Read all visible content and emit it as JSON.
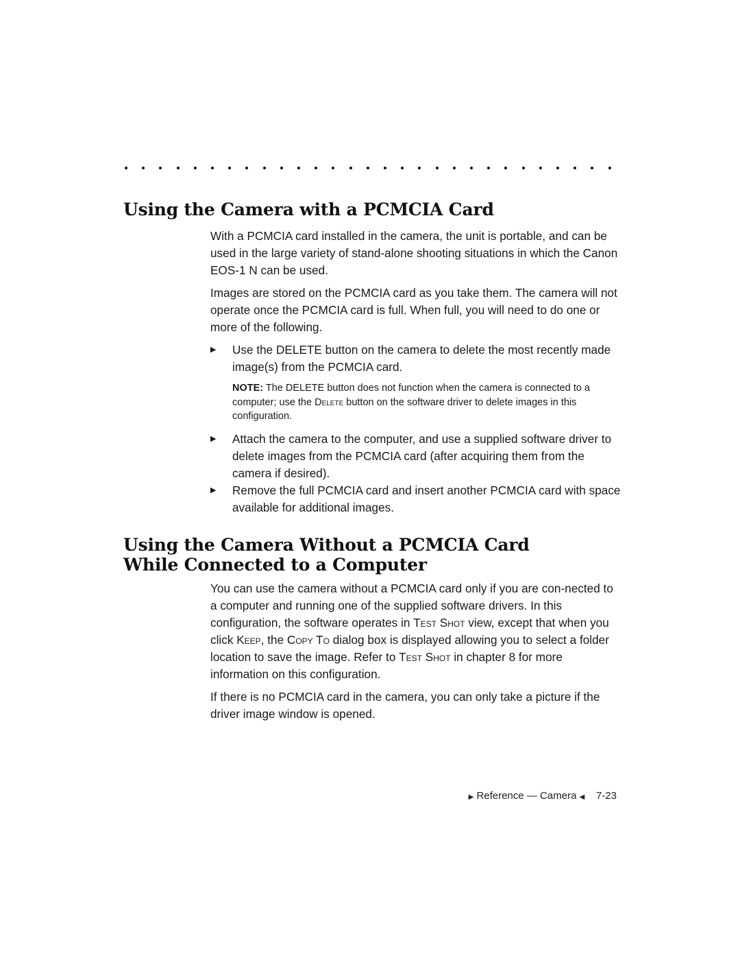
{
  "divider": {
    "dot_count": 29
  },
  "section1": {
    "heading": "Using the Camera with a PCMCIA Card",
    "para1": "With a PCMCIA card installed in the camera, the unit is portable, and can be used in the large variety of stand-alone shooting situations in which the Canon EOS-1 N can be used.",
    "para2": "Images are stored on the PCMCIA card as you take them. The camera will not operate once the PCMCIA card is full. When full, you will need to do one or more of the following.",
    "bullets": [
      {
        "glyph": "▶",
        "text": "Use the DELETE button on the camera to delete the most recently made image(s) from the PCMCIA card."
      },
      {
        "glyph": "▶",
        "text": "Attach the camera to the computer, and use a supplied software driver to delete images from the PCMCIA card (after acquiring them from the camera if desired)."
      },
      {
        "glyph": "▶",
        "text": "Remove the full PCMCIA card and insert another PCMCIA card with space available for additional images."
      }
    ],
    "note": {
      "label": "NOTE:",
      "text_before": " The DELETE button does not function when the camera is connected to a computer; use the ",
      "smallcaps": "Delete",
      "text_after": " button on the software driver to delete images in this configuration."
    }
  },
  "section2": {
    "heading_line1": "Using the Camera Without a PCMCIA Card",
    "heading_line2": "While Connected to a Computer",
    "para1": {
      "t1": "You can use the camera without a PCMCIA card only if you are con-nected to a computer and running one of the supplied software drivers. In this configuration, the software operates in ",
      "sc1": "Test Shot",
      "t2": " view, except that when you click ",
      "sc2": "Keep",
      "t3": ", the ",
      "sc3": "Copy To",
      "t4": " dialog box is displayed allowing you to select a folder location to save the image. Refer to ",
      "sc4": "Test Shot",
      "t5": " in chapter 8 for more information on this configuration."
    },
    "para2": "If there is no PCMCIA card in the camera, you can only take a picture if the driver image window is opened."
  },
  "footer": {
    "left_glyph": "▶",
    "label": "Reference — Camera",
    "right_glyph": "◀",
    "page_number": "7-23"
  }
}
